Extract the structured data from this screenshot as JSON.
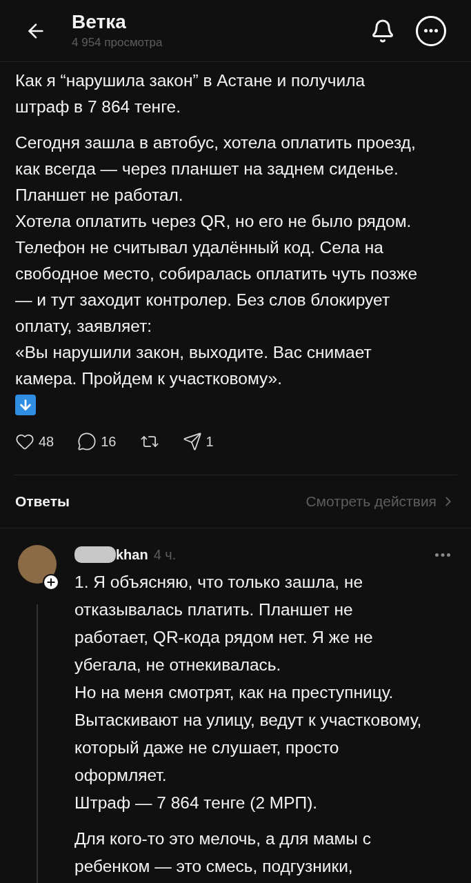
{
  "header": {
    "title": "Ветка",
    "subtitle": "4 954 просмотра"
  },
  "post": {
    "paragraphs": [
      "Как я “нарушила закон” в Астане и получила штраф в 7 864 тенге.",
      "Сегодня зашла в автобус, хотела оплатить проезд, как всегда — через планшет на заднем сиденье. Планшет не работал.\nХотела оплатить через QR, но его не было рядом. Телефон не считывал удалённый код. Села на свободное место, собиралась оплатить чуть позже — и тут заходит контролер. Без слов блокирует оплату, заявляет:\n«Вы нарушили закон, выходите. Вас снимает камера. Пройдем к участковому»."
    ],
    "stats": [
      {
        "kind": "like",
        "count": "48"
      },
      {
        "kind": "reply",
        "count": "16"
      },
      {
        "kind": "repost"
      },
      {
        "kind": "share",
        "count": "1"
      }
    ]
  },
  "replies_header": {
    "title": "Ответы",
    "action": "Смотреть действия"
  },
  "comment": {
    "author": "khan",
    "time": "4 ч.",
    "paragraphs": [
      "1. Я объясняю, что только зашла, не отказывалась платить. Планшет не работает, QR-кода рядом нет. Я же не убегала, не отнекивалась.\nНо на меня смотрят, как на преступницу. Вытаскивают на улицу, ведут к участковому, который даже не слушает, просто оформляет.\nШтраф — 7 864 тенге (2 МРП).",
      "Для кого-то это мелочь, а для мамы с ребенком — это смесь, подгузники,"
    ]
  }
}
